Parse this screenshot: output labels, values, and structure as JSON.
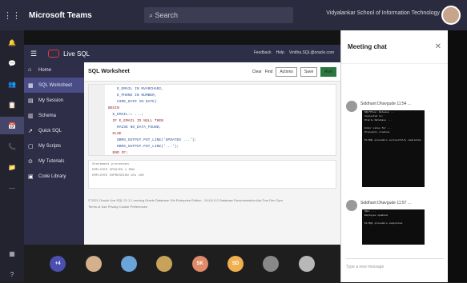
{
  "teams": {
    "app_title": "Microsoft Teams",
    "search_placeholder": "Search",
    "org_label": "Vidyalankar School of Information Technology"
  },
  "app": {
    "header_name": "Live SQL",
    "header_right": [
      "Feedback",
      "Help",
      "Vinitha.SQL@oracle.com"
    ],
    "nav": [
      {
        "label": "Home",
        "icon": "⌂"
      },
      {
        "label": "SQL Worksheet",
        "icon": "▦"
      },
      {
        "label": "My Session",
        "icon": "▤"
      },
      {
        "label": "Schema",
        "icon": "▥"
      },
      {
        "label": "Quick SQL",
        "icon": "↗"
      },
      {
        "label": "My Scripts",
        "icon": "▢"
      },
      {
        "label": "My Tutorials",
        "icon": "⊙"
      },
      {
        "label": "Code Library",
        "icon": "▣"
      }
    ]
  },
  "worksheet": {
    "title": "SQL Worksheet",
    "toolbar": [
      "Clear",
      "Find",
      "Actions",
      "Save",
      "Run"
    ],
    "code": [
      {
        "t": "    E_EMAIL IN NVARCHAR2,"
      },
      {
        "t": "    E_PHONE IN NUMBER,"
      },
      {
        "t": "    HIRE_DATE IN DATE)"
      },
      {
        "t": "BEGIN",
        "kw": true
      },
      {
        "t": "  E_EMAIL:= ...;"
      },
      {
        "t": "  IF E_EMAIL IS NULL THEN",
        "kw": true
      },
      {
        "t": "    RAISE NO_DATA_FOUND;"
      },
      {
        "t": "  ELSE",
        "kw": true
      },
      {
        "t": "    DBMS_OUTPUT.PUT_LINE('UPDATED ...');"
      },
      {
        "t": "    DBMS_OUTPUT.PUT_LINE('...');"
      },
      {
        "t": "  END IF;",
        "kw": true
      },
      {
        "t": "EXCEPTION",
        "kw": true
      },
      {
        "t": "  WHEN NO_DATA_FOUND THEN",
        "kw": true
      }
    ],
    "results": [
      "Statement processed.",
      "EMPLOYEE UPDATED 1 ROW",
      "EMPLOYEE EXPRESSION 101 100"
    ],
    "footer": [
      "© 2021 Oracle  Live SQL 21.1.1  running Oracle Database 19c Enterprise Edition - 19.8.0.0.0  Database Documentation  Ask Tom  Dev Gym",
      "Terms of Use  Privacy  Cookie Preferences"
    ]
  },
  "participants": [
    {
      "label": "+4",
      "color": "#4a4fb0"
    },
    {
      "label": "",
      "color": "#d4b08c"
    },
    {
      "label": "",
      "color": "#6aa4d8"
    },
    {
      "label": "",
      "color": "#c9a25a"
    },
    {
      "label": "SK",
      "color": "#e08a6a"
    },
    {
      "label": "SD",
      "color": "#f0b050"
    },
    {
      "label": "",
      "color": "#888888"
    },
    {
      "label": "",
      "color": "#b8b8b8"
    }
  ],
  "chat": {
    "title": "Meeting chat",
    "close_icon": "close-icon",
    "messages": [
      {
        "name": "Siddhant Dhavgude  11:54 ...",
        "lines": [
          "SQL*Plus: Release ...",
          "Connected to:",
          "Oracle Database ...",
          "",
          "Enter value for ...",
          "Procedure created.",
          "",
          "PL/SQL procedure successfully completed."
        ]
      },
      {
        "name": "Siddhant Dhavgude  11:57 ...",
        "lines": [
          "SQL> ...",
          "Employee updated",
          "",
          "PL/SQL procedure completed."
        ]
      }
    ],
    "compose_placeholder": "Type a new message"
  }
}
